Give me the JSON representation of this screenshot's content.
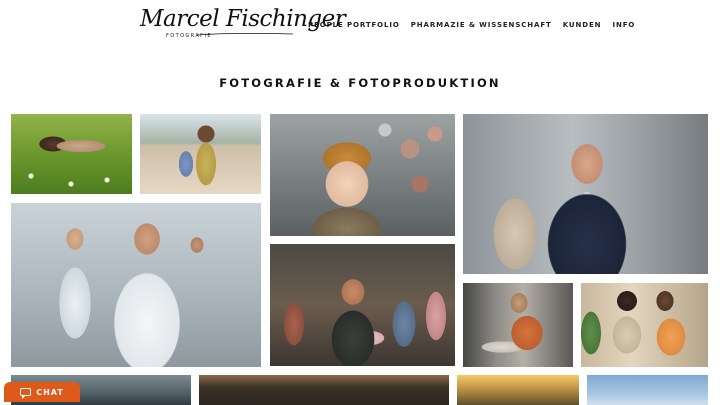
{
  "brand": {
    "name": "Marcel Fischinger",
    "sub": "FOTOGRAFIE"
  },
  "nav": {
    "items": [
      {
        "label": "PEOPLE PORTFOLIO"
      },
      {
        "label": "PHARMAZIE & WISSENSCHAFT"
      },
      {
        "label": "KUNDEN"
      },
      {
        "label": "INFO"
      }
    ]
  },
  "main": {
    "title": "FOTOGRAFIE & FOTOPRODUKTION"
  },
  "chat": {
    "label": "CHAT",
    "color": "#dd5a1b"
  }
}
